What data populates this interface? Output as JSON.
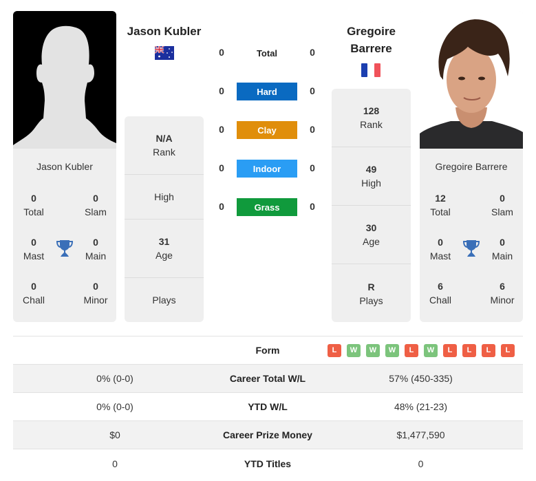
{
  "player1": {
    "name": "Jason Kubler",
    "country": "Australia",
    "flag_icon": "australia-flag-icon",
    "photo": "silhouette-placeholder",
    "titles": {
      "total": {
        "value": "0",
        "label": "Total"
      },
      "slam": {
        "value": "0",
        "label": "Slam"
      },
      "mast": {
        "value": "0",
        "label": "Mast"
      },
      "main": {
        "value": "0",
        "label": "Main"
      },
      "chall": {
        "value": "0",
        "label": "Chall"
      },
      "minor": {
        "value": "0",
        "label": "Minor"
      }
    },
    "stats": {
      "rank": {
        "value": "N/A",
        "label": "Rank"
      },
      "high": {
        "value": "",
        "label": "High"
      },
      "age": {
        "value": "31",
        "label": "Age"
      },
      "plays": {
        "value": "",
        "label": "Plays"
      }
    }
  },
  "player2": {
    "name_line1": "Gregoire",
    "name_line2": "Barrere",
    "name": "Gregoire Barrere",
    "country": "France",
    "flag_icon": "france-flag-icon",
    "photo": "player-portrait",
    "titles": {
      "total": {
        "value": "12",
        "label": "Total"
      },
      "slam": {
        "value": "0",
        "label": "Slam"
      },
      "mast": {
        "value": "0",
        "label": "Mast"
      },
      "main": {
        "value": "0",
        "label": "Main"
      },
      "chall": {
        "value": "6",
        "label": "Chall"
      },
      "minor": {
        "value": "6",
        "label": "Minor"
      }
    },
    "stats": {
      "rank": {
        "value": "128",
        "label": "Rank"
      },
      "high": {
        "value": "49",
        "label": "High"
      },
      "age": {
        "value": "30",
        "label": "Age"
      },
      "plays": {
        "value": "R",
        "label": "Plays"
      }
    }
  },
  "h2h": {
    "rows": [
      {
        "label": "Total",
        "p1": "0",
        "p2": "0",
        "color": ""
      },
      {
        "label": "Hard",
        "p1": "0",
        "p2": "0",
        "color": "#0a6ac1"
      },
      {
        "label": "Clay",
        "p1": "0",
        "p2": "0",
        "color": "#e08e0b"
      },
      {
        "label": "Indoor",
        "p1": "0",
        "p2": "0",
        "color": "#2a9df4"
      },
      {
        "label": "Grass",
        "p1": "0",
        "p2": "0",
        "color": "#109a3c"
      }
    ]
  },
  "comparison": {
    "form_label": "Form",
    "form": [
      "L",
      "W",
      "W",
      "W",
      "L",
      "W",
      "L",
      "L",
      "L",
      "L"
    ],
    "form_colors": {
      "W": "#7cc47c",
      "L": "#ef5f45"
    },
    "rows": [
      {
        "label": "Career Total W/L",
        "p1": "0% (0-0)",
        "p2": "57% (450-335)"
      },
      {
        "label": "YTD W/L",
        "p1": "0% (0-0)",
        "p2": "48% (21-23)"
      },
      {
        "label": "Career Prize Money",
        "p1": "$0",
        "p2": "$1,477,590"
      },
      {
        "label": "YTD Titles",
        "p1": "0",
        "p2": "0"
      }
    ]
  },
  "colors": {
    "trophy": "#3a6fb8",
    "card_bg": "#efefef"
  }
}
